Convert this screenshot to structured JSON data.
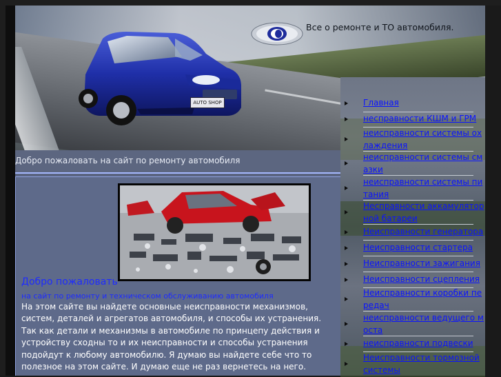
{
  "header": {
    "tagline": "Все о ремонте и ТО автомобиля.",
    "car_plate": "AUTO SHOP"
  },
  "main": {
    "welcome_strip": "Добро пожаловать на сайт по ремонту автомобиля",
    "heading": "Добро пожаловать",
    "subheading": "на сайт по ремонту и техническом обслуживанию автомобиля",
    "paragraphs": [
      "На этом сайте вы найдете основные неисправности механизмов, систем, деталей и агрегатов автомобиля, и способы их устранения.",
      "Так как детали и механизмы в автомобиле по принцепу действия и устройству сходны то и их неисправности и способы устранения подойдут к любому автомобилю. Я думаю вы найдете себе что то полезное на этом сайте. И думаю еще не раз вернетесь на него."
    ]
  },
  "sidebar": {
    "items": [
      {
        "label": "Главная"
      },
      {
        "label": "несправности КШМ и ГРМ"
      },
      {
        "label": "неисправности системы охлаждения"
      },
      {
        "label": "неисправности системы смазки"
      },
      {
        "label": "неисправности системы питания"
      },
      {
        "label": "Несправности аккамуляторной батареи"
      },
      {
        "label": "Неисправности генератора"
      },
      {
        "label": "Неисправности стартера"
      },
      {
        "label": "Неисправности зажигания"
      },
      {
        "label": "Неисправности сцепления"
      },
      {
        "label": "Неисправности коробки передач"
      },
      {
        "label": "неисправности ведущего моста"
      },
      {
        "label": "неисправности подвески"
      },
      {
        "label": "Неисправности тормозной системы"
      }
    ]
  },
  "colors": {
    "link": "#0a13ff",
    "heading": "#1d2bff",
    "content_bg": "#5e6a8a",
    "accent_line": "#a6b9ff"
  }
}
